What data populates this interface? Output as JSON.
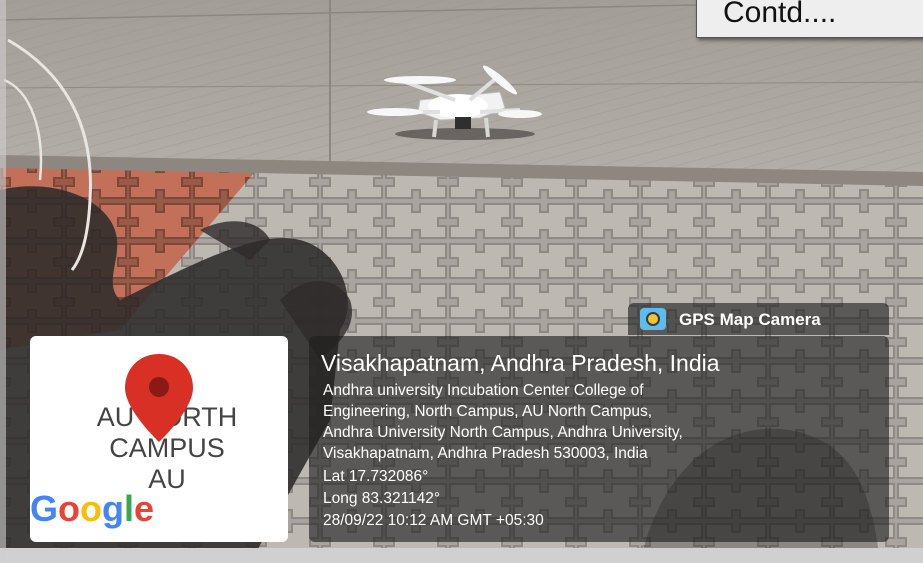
{
  "overlay_label": "Contd....",
  "map": {
    "place_line1": "AU NORTH",
    "place_line2": "CAMPUS",
    "place_line3": "AU",
    "google": {
      "letters": [
        "G",
        "o",
        "o",
        "g",
        "l",
        "e"
      ],
      "colors": [
        "#4285F4",
        "#EA4335",
        "#FBBC05",
        "#4285F4",
        "#34A853",
        "#EA4335"
      ]
    },
    "pin_color": "#D93025"
  },
  "gps_badge": {
    "label": "GPS Map Camera",
    "icon": "camera-lens-icon"
  },
  "location": {
    "title": "Visakhapatnam, Andhra Pradesh, India",
    "address_lines": [
      "Andhra university Incubation Center College of",
      "Engineering, North Campus, AU North Campus,",
      "Andhra University North Campus, Andhra University,",
      "Visakhapatnam, Andhra Pradesh 530003, India"
    ],
    "lat": "Lat 17.732086°",
    "long": "Long 83.321142°",
    "timestamp": "28/09/22 10:12 AM GMT +05:30"
  }
}
